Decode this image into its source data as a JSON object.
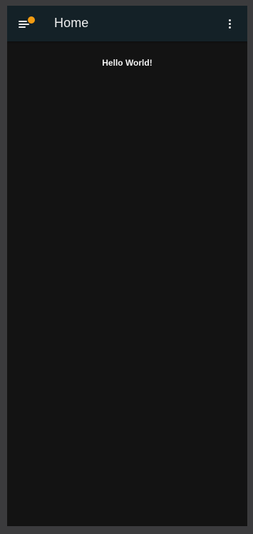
{
  "app_bar": {
    "title": "Home",
    "menu_icon": "hamburger-menu-icon",
    "badge_color": "#f39c12",
    "overflow_icon": "more-vert-icon",
    "background_color": "#142127"
  },
  "main": {
    "greeting": "Hello World!",
    "background_color": "#131313"
  }
}
